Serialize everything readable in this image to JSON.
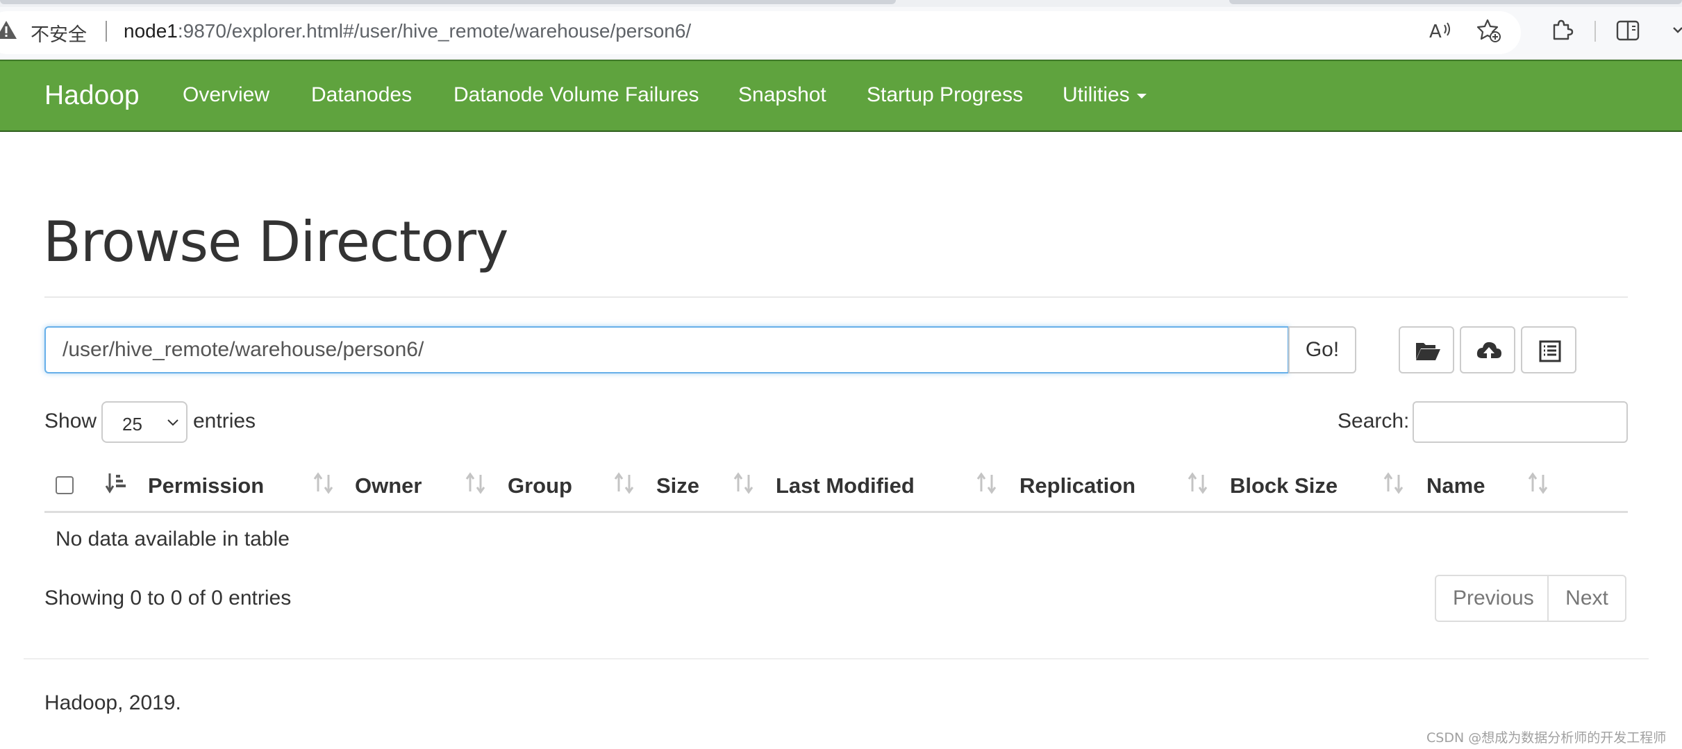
{
  "browser": {
    "security_label": "不安全",
    "url_host": "node1",
    "url_rest": ":9870/explorer.html#/user/hive_remote/warehouse/person6/",
    "toolbar_icons": [
      "read-aloud-icon",
      "add-favorite-icon",
      "extensions-icon",
      "split-screen-icon",
      "chevron-down-icon"
    ]
  },
  "navbar": {
    "brand": "Hadoop",
    "items": [
      {
        "label": "Overview"
      },
      {
        "label": "Datanodes"
      },
      {
        "label": "Datanode Volume Failures"
      },
      {
        "label": "Snapshot"
      },
      {
        "label": "Startup Progress"
      },
      {
        "label": "Utilities"
      }
    ],
    "color": "#5fa33e"
  },
  "page": {
    "title": "Browse Directory",
    "path_value": "/user/hive_remote/warehouse/person6/",
    "go_label": "Go!",
    "action_icons": [
      "folder-open-icon",
      "cloud-upload-icon",
      "list-icon"
    ]
  },
  "table": {
    "show_label": "Show",
    "entries_value": "25",
    "entries_label": "entries",
    "search_label": "Search:",
    "columns": [
      "Permission",
      "Owner",
      "Group",
      "Size",
      "Last Modified",
      "Replication",
      "Block Size",
      "Name"
    ],
    "empty_message": "No data available in table",
    "info": "Showing 0 to 0 of 0 entries",
    "prev_label": "Previous",
    "next_label": "Next"
  },
  "footer": {
    "text": "Hadoop, 2019."
  },
  "watermark": "CSDN @想成为数据分析师的开发工程师"
}
